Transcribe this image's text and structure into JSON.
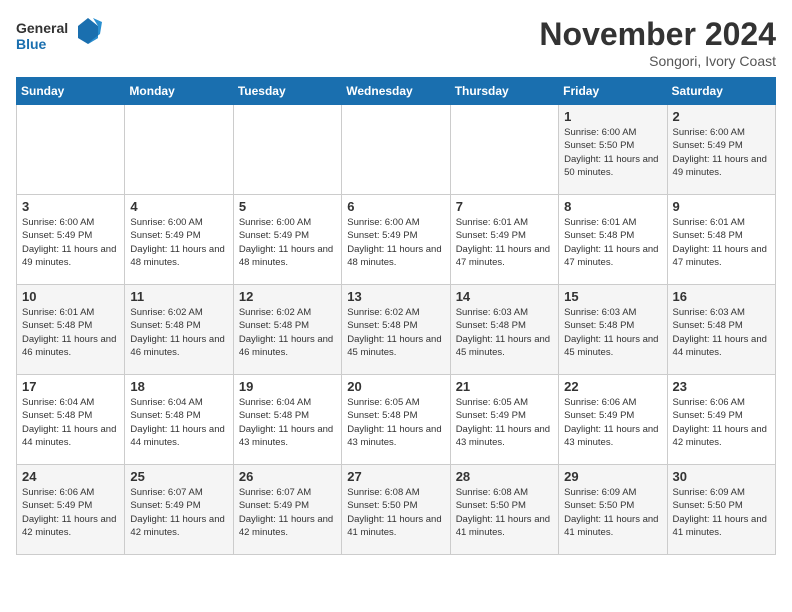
{
  "logo": {
    "line1": "General",
    "line2": "Blue"
  },
  "title": "November 2024",
  "subtitle": "Songori, Ivory Coast",
  "days_of_week": [
    "Sunday",
    "Monday",
    "Tuesday",
    "Wednesday",
    "Thursday",
    "Friday",
    "Saturday"
  ],
  "weeks": [
    [
      {
        "day": "",
        "info": ""
      },
      {
        "day": "",
        "info": ""
      },
      {
        "day": "",
        "info": ""
      },
      {
        "day": "",
        "info": ""
      },
      {
        "day": "",
        "info": ""
      },
      {
        "day": "1",
        "info": "Sunrise: 6:00 AM\nSunset: 5:50 PM\nDaylight: 11 hours and 50 minutes."
      },
      {
        "day": "2",
        "info": "Sunrise: 6:00 AM\nSunset: 5:49 PM\nDaylight: 11 hours and 49 minutes."
      }
    ],
    [
      {
        "day": "3",
        "info": "Sunrise: 6:00 AM\nSunset: 5:49 PM\nDaylight: 11 hours and 49 minutes."
      },
      {
        "day": "4",
        "info": "Sunrise: 6:00 AM\nSunset: 5:49 PM\nDaylight: 11 hours and 48 minutes."
      },
      {
        "day": "5",
        "info": "Sunrise: 6:00 AM\nSunset: 5:49 PM\nDaylight: 11 hours and 48 minutes."
      },
      {
        "day": "6",
        "info": "Sunrise: 6:00 AM\nSunset: 5:49 PM\nDaylight: 11 hours and 48 minutes."
      },
      {
        "day": "7",
        "info": "Sunrise: 6:01 AM\nSunset: 5:49 PM\nDaylight: 11 hours and 47 minutes."
      },
      {
        "day": "8",
        "info": "Sunrise: 6:01 AM\nSunset: 5:48 PM\nDaylight: 11 hours and 47 minutes."
      },
      {
        "day": "9",
        "info": "Sunrise: 6:01 AM\nSunset: 5:48 PM\nDaylight: 11 hours and 47 minutes."
      }
    ],
    [
      {
        "day": "10",
        "info": "Sunrise: 6:01 AM\nSunset: 5:48 PM\nDaylight: 11 hours and 46 minutes."
      },
      {
        "day": "11",
        "info": "Sunrise: 6:02 AM\nSunset: 5:48 PM\nDaylight: 11 hours and 46 minutes."
      },
      {
        "day": "12",
        "info": "Sunrise: 6:02 AM\nSunset: 5:48 PM\nDaylight: 11 hours and 46 minutes."
      },
      {
        "day": "13",
        "info": "Sunrise: 6:02 AM\nSunset: 5:48 PM\nDaylight: 11 hours and 45 minutes."
      },
      {
        "day": "14",
        "info": "Sunrise: 6:03 AM\nSunset: 5:48 PM\nDaylight: 11 hours and 45 minutes."
      },
      {
        "day": "15",
        "info": "Sunrise: 6:03 AM\nSunset: 5:48 PM\nDaylight: 11 hours and 45 minutes."
      },
      {
        "day": "16",
        "info": "Sunrise: 6:03 AM\nSunset: 5:48 PM\nDaylight: 11 hours and 44 minutes."
      }
    ],
    [
      {
        "day": "17",
        "info": "Sunrise: 6:04 AM\nSunset: 5:48 PM\nDaylight: 11 hours and 44 minutes."
      },
      {
        "day": "18",
        "info": "Sunrise: 6:04 AM\nSunset: 5:48 PM\nDaylight: 11 hours and 44 minutes."
      },
      {
        "day": "19",
        "info": "Sunrise: 6:04 AM\nSunset: 5:48 PM\nDaylight: 11 hours and 43 minutes."
      },
      {
        "day": "20",
        "info": "Sunrise: 6:05 AM\nSunset: 5:48 PM\nDaylight: 11 hours and 43 minutes."
      },
      {
        "day": "21",
        "info": "Sunrise: 6:05 AM\nSunset: 5:49 PM\nDaylight: 11 hours and 43 minutes."
      },
      {
        "day": "22",
        "info": "Sunrise: 6:06 AM\nSunset: 5:49 PM\nDaylight: 11 hours and 43 minutes."
      },
      {
        "day": "23",
        "info": "Sunrise: 6:06 AM\nSunset: 5:49 PM\nDaylight: 11 hours and 42 minutes."
      }
    ],
    [
      {
        "day": "24",
        "info": "Sunrise: 6:06 AM\nSunset: 5:49 PM\nDaylight: 11 hours and 42 minutes."
      },
      {
        "day": "25",
        "info": "Sunrise: 6:07 AM\nSunset: 5:49 PM\nDaylight: 11 hours and 42 minutes."
      },
      {
        "day": "26",
        "info": "Sunrise: 6:07 AM\nSunset: 5:49 PM\nDaylight: 11 hours and 42 minutes."
      },
      {
        "day": "27",
        "info": "Sunrise: 6:08 AM\nSunset: 5:50 PM\nDaylight: 11 hours and 41 minutes."
      },
      {
        "day": "28",
        "info": "Sunrise: 6:08 AM\nSunset: 5:50 PM\nDaylight: 11 hours and 41 minutes."
      },
      {
        "day": "29",
        "info": "Sunrise: 6:09 AM\nSunset: 5:50 PM\nDaylight: 11 hours and 41 minutes."
      },
      {
        "day": "30",
        "info": "Sunrise: 6:09 AM\nSunset: 5:50 PM\nDaylight: 11 hours and 41 minutes."
      }
    ]
  ]
}
